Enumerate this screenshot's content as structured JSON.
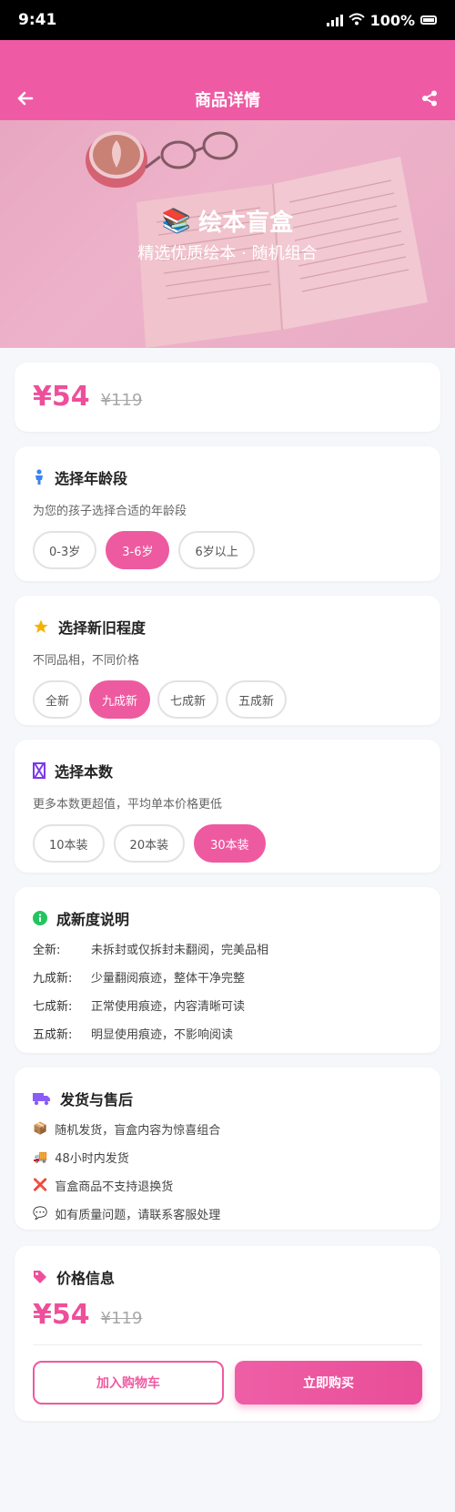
{
  "status_bar": {
    "time": "9:41",
    "battery": "100%"
  },
  "nav": {
    "title": "商品详情"
  },
  "hero": {
    "emoji": "📚",
    "title": "绘本盲盒",
    "subtitle": "精选优质绘本 · 随机组合"
  },
  "price_top": {
    "price": "¥54",
    "original": "¥119"
  },
  "age": {
    "title": "选择年龄段",
    "desc": "为您的孩子选择合适的年龄段",
    "options": [
      "0-3岁",
      "3-6岁",
      "6岁以上"
    ],
    "selected": "3-6岁"
  },
  "condition_select": {
    "title": "选择新旧程度",
    "desc": "不同品相，不同价格",
    "options": [
      "全新",
      "九成新",
      "七成新",
      "五成新"
    ],
    "selected": "九成新"
  },
  "count": {
    "title": "选择本数",
    "desc": "更多本数更超值，平均单本价格更低",
    "options": [
      "10本装",
      "20本装",
      "30本装"
    ],
    "selected": "30本装"
  },
  "condition_info": {
    "title": "成新度说明",
    "rows": [
      {
        "key": "全新:",
        "value": "未拆封或仅拆封未翻阅，完美品相"
      },
      {
        "key": "九成新:",
        "value": "少量翻阅痕迹，整体干净完整"
      },
      {
        "key": "七成新:",
        "value": "正常使用痕迹，内容清晰可读"
      },
      {
        "key": "五成新:",
        "value": "明显使用痕迹，不影响阅读"
      }
    ]
  },
  "shipping": {
    "title": "发货与售后",
    "items": [
      {
        "icon": "📦",
        "text": "随机发货，盲盒内容为惊喜组合"
      },
      {
        "icon": "🚚",
        "text": "48小时内发货"
      },
      {
        "icon": "❌",
        "text": "盲盒商品不支持退换货"
      },
      {
        "icon": "💬",
        "text": "如有质量问题，请联系客服处理"
      }
    ]
  },
  "price_info": {
    "title": "价格信息",
    "price": "¥54",
    "original": "¥119",
    "add_cart": "加入购物车",
    "buy_now": "立即购买"
  },
  "colors": {
    "brand": "#ee5ba4",
    "price": "#ee4f9a",
    "muted": "#a8a8a8"
  }
}
